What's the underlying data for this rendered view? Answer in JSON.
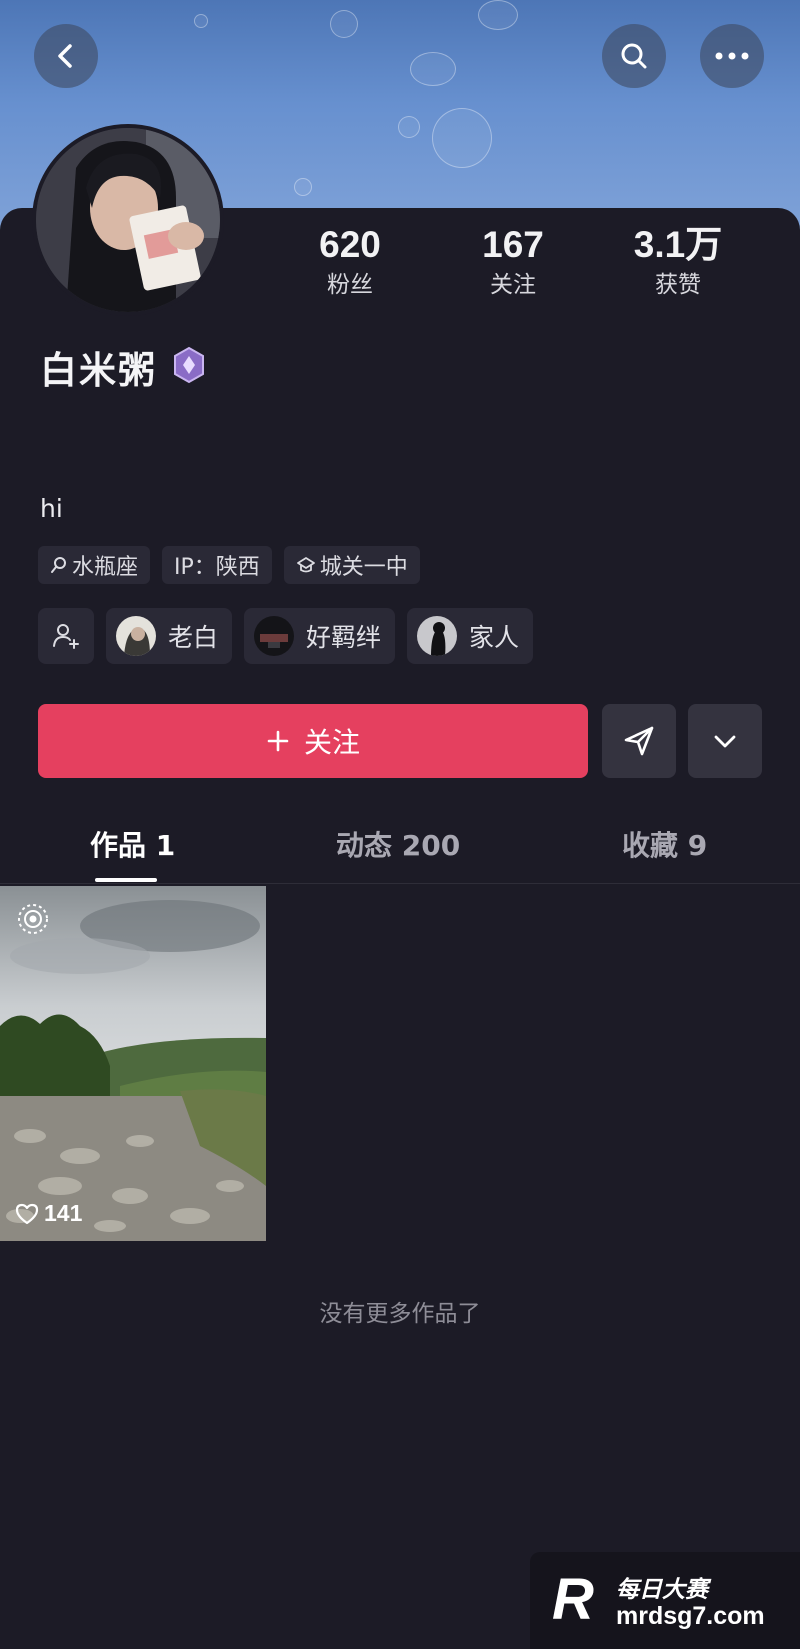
{
  "profile": {
    "name": "白米粥",
    "bio": "hi",
    "stats": [
      {
        "value": "620",
        "label": "粉丝"
      },
      {
        "value": "167",
        "label": "关注"
      },
      {
        "value": "3.1万",
        "label": "获赞"
      }
    ],
    "tags": [
      "水瓶座",
      "IP：陕西",
      "城关一中"
    ],
    "friends": [
      "老白",
      "好羁绊",
      "家人"
    ]
  },
  "actions": {
    "follow_label": "关注"
  },
  "tabs": [
    {
      "label": "作品 1",
      "active": true
    },
    {
      "label": "动态 200",
      "active": false
    },
    {
      "label": "收藏 9",
      "active": false
    }
  ],
  "posts": [
    {
      "likes": "141"
    }
  ],
  "footer": {
    "no_more": "没有更多作品了"
  },
  "watermark": {
    "top": "每日大赛",
    "bottom": "mrdsg7.com",
    "logo": "R"
  },
  "colors": {
    "accent": "#e5405f",
    "background": "#1c1b26"
  },
  "icons": [
    "back-icon",
    "search-icon",
    "more-icon",
    "badge-icon",
    "location-icon",
    "school-icon",
    "add-friend-icon",
    "plus-icon",
    "send-icon",
    "chevron-down-icon",
    "heart-icon",
    "live-icon"
  ]
}
